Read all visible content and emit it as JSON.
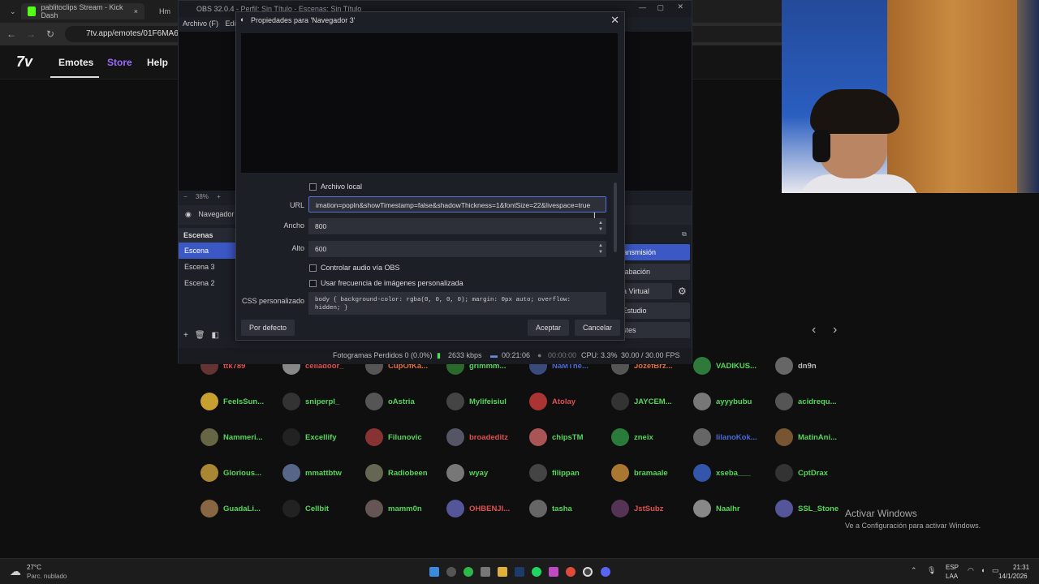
{
  "browser": {
    "tabs": [
      {
        "label": "pablitoclips Stream - Kick Dash",
        "close": "×",
        "fav": "#53fc18"
      },
      {
        "label": "Hm",
        "close": "",
        "fav": "#444"
      }
    ],
    "url": "7tv.app/emotes/01F6MA6Y"
  },
  "site": {
    "logo": "7v",
    "nav": [
      {
        "label": "Emotes",
        "color": "#eeeeee"
      },
      {
        "label": "Store",
        "color": "#9b6bff"
      },
      {
        "label": "Help",
        "color": "#eeeeee"
      }
    ]
  },
  "obs": {
    "title": "OBS 32.0.4 - Perfil: Sin Título - Escenas: Sin Título",
    "menu": [
      "Archivo (F)",
      "Edi"
    ],
    "zoom": "38%",
    "source_name": "Navegador",
    "scenes_header": "Escenas",
    "scenes": [
      {
        "label": "Escena",
        "selected": true
      },
      {
        "label": "Escena 3",
        "selected": false
      },
      {
        "label": "Escena 2",
        "selected": false
      }
    ],
    "controls": [
      {
        "label": "r Transmisión",
        "primary": true
      },
      {
        "label": "r Grabación",
        "primary": false
      },
      {
        "label": "nara Virtual",
        "primary": false
      },
      {
        "label": "do Estudio",
        "primary": false
      },
      {
        "label": "Ajustes",
        "primary": false
      }
    ],
    "status": {
      "dropped": "Fotogramas Perdidos 0 (0.0%)",
      "bitrate": "2633 kbps",
      "rec_time": "00:21:06",
      "stream_time": "00:00:00",
      "cpu": "CPU: 3.3%",
      "fps": "30.00 / 30.00 FPS"
    }
  },
  "dialog": {
    "title": "Propiedades para 'Navegador 3'",
    "local_file_label": "Archivo local",
    "local_file_checked": false,
    "url_label": "URL",
    "url_value": "imation=popIn&showTimestamp=false&shadowThickness=1&fontSize=22&livespace=true",
    "width_label": "Ancho",
    "width_value": "800",
    "height_label": "Alto",
    "height_value": "600",
    "audio_label": "Controlar audio vía OBS",
    "fps_label": "Usar frecuencia de imágenes personalizada",
    "css_label": "CSS personalizado",
    "css_value_1": "body { background-color: rgba(0, 0, 0, 0); margin: 0px auto; overflow:",
    "css_value_2": "hidden; }",
    "default_button": "Por defecto",
    "accept_button": "Aceptar",
    "cancel_button": "Cancelar"
  },
  "emotes": [
    {
      "name": "ttk789",
      "color": "#e05050",
      "av": "#663333"
    },
    {
      "name": "celladoor_",
      "color": "#e05050",
      "av": "#888"
    },
    {
      "name": "CupOfKa...",
      "color": "#e07040",
      "av": "#555"
    },
    {
      "name": "grimmm...",
      "color": "#56d65a",
      "av": "#2a6a2a"
    },
    {
      "name": "NaMThe...",
      "color": "#4a6ad6",
      "av": "#3a4a7a"
    },
    {
      "name": "JozefBrz...",
      "color": "#e07040",
      "av": "#555"
    },
    {
      "name": "VADIKUS...",
      "color": "#56d65a",
      "av": "#2e7a3a"
    },
    {
      "name": "dn9n",
      "color": "#bbbbbb",
      "av": "#666"
    },
    {
      "name": "FeelsSun...",
      "color": "#56d65a",
      "av": "#c8a030"
    },
    {
      "name": "sniperpl_",
      "color": "#56d65a",
      "av": "#333"
    },
    {
      "name": "oAstria",
      "color": "#56d65a",
      "av": "#555"
    },
    {
      "name": "Mylifeisiul",
      "color": "#56d65a",
      "av": "#444"
    },
    {
      "name": "Atolay",
      "color": "#e05050",
      "av": "#a33"
    },
    {
      "name": "JAYCEM...",
      "color": "#56d65a",
      "av": "#333"
    },
    {
      "name": "ayyybubu",
      "color": "#56d65a",
      "av": "#777"
    },
    {
      "name": "acidrequ...",
      "color": "#56d65a",
      "av": "#555"
    },
    {
      "name": "Nammeri...",
      "color": "#56d65a",
      "av": "#664"
    },
    {
      "name": "Excellify",
      "color": "#56d65a",
      "av": "#222"
    },
    {
      "name": "Filunovic",
      "color": "#56d65a",
      "av": "#833"
    },
    {
      "name": "broadeditz",
      "color": "#e05050",
      "av": "#556"
    },
    {
      "name": "chipsTM",
      "color": "#56d65a",
      "av": "#a55"
    },
    {
      "name": "zneix",
      "color": "#56d65a",
      "av": "#2a7a3a"
    },
    {
      "name": "lilanoKok...",
      "color": "#4a6ad6",
      "av": "#666"
    },
    {
      "name": "MatinAni...",
      "color": "#56d65a",
      "av": "#753"
    },
    {
      "name": "Glorious...",
      "color": "#56d65a",
      "av": "#a83"
    },
    {
      "name": "mmattbtw",
      "color": "#56d65a",
      "av": "#568"
    },
    {
      "name": "Radiobeen",
      "color": "#56d65a",
      "av": "#665"
    },
    {
      "name": "wyay",
      "color": "#56d65a",
      "av": "#777"
    },
    {
      "name": "filippan",
      "color": "#56d65a",
      "av": "#444"
    },
    {
      "name": "bramaale",
      "color": "#56d65a",
      "av": "#a73"
    },
    {
      "name": "xseba___",
      "color": "#56d65a",
      "av": "#35a"
    },
    {
      "name": "CptDrax",
      "color": "#56d65a",
      "av": "#333"
    },
    {
      "name": "GuadaLi...",
      "color": "#56d65a",
      "av": "#864"
    },
    {
      "name": "Cellbit",
      "color": "#56d65a",
      "av": "#222"
    },
    {
      "name": "mamm0n",
      "color": "#56d65a",
      "av": "#655"
    },
    {
      "name": "OHBENJI...",
      "color": "#e05050",
      "av": "#559"
    },
    {
      "name": "tasha",
      "color": "#56d65a",
      "av": "#666"
    },
    {
      "name": "JstSubz",
      "color": "#e05050",
      "av": "#535"
    },
    {
      "name": "Naalhr",
      "color": "#56d65a",
      "av": "#888"
    },
    {
      "name": "SSL_Stone",
      "color": "#56d65a",
      "av": "#559"
    }
  ],
  "watermark": {
    "title": "Activar Windows",
    "subtitle": "Ve a Configuración para activar Windows."
  },
  "taskbar": {
    "weather_temp": "27°C",
    "weather_desc": "Parc. nublado",
    "lang": "ESP",
    "lang_sub": "LAA",
    "time": "21:31",
    "date": "14/1/2026"
  }
}
